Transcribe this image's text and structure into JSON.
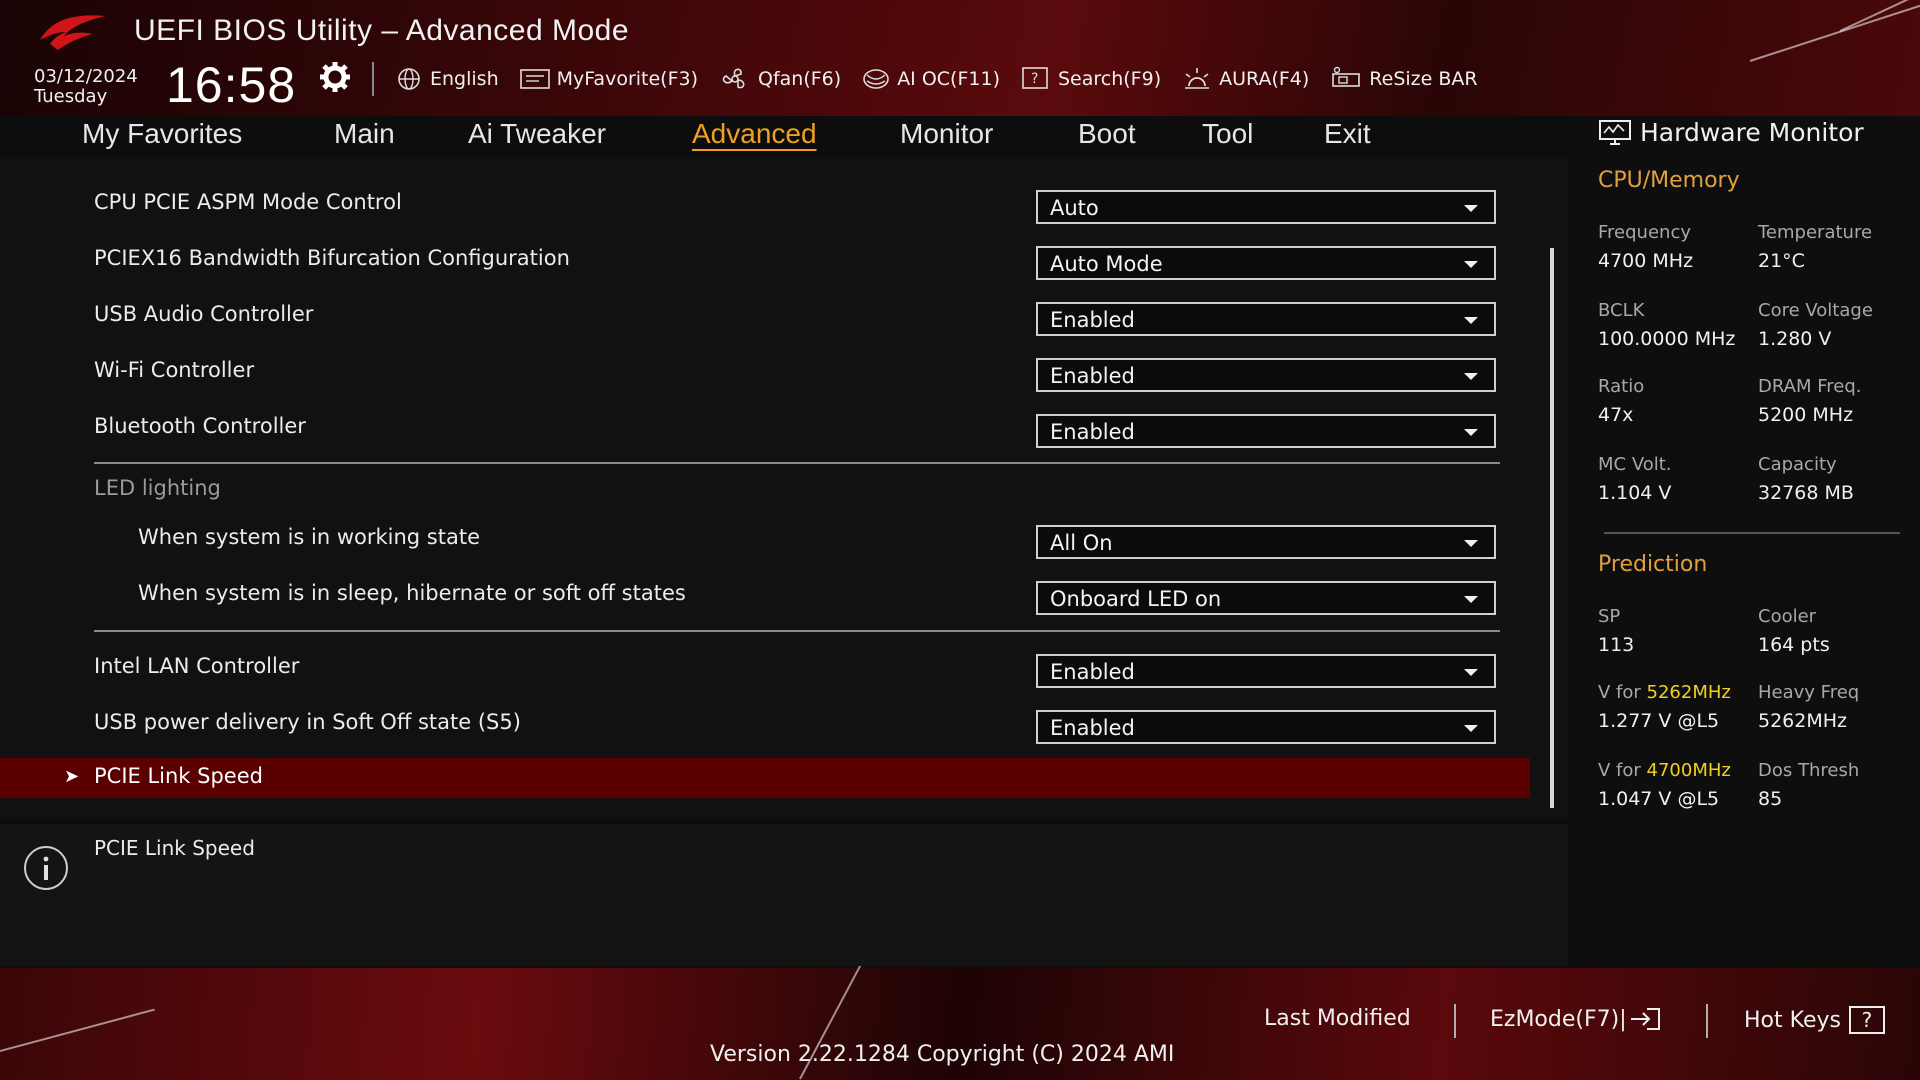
{
  "app": {
    "title": "UEFI BIOS Utility – Advanced Mode",
    "date": "03/12/2024",
    "day": "Tuesday",
    "time": "16:58"
  },
  "toolbar": {
    "items": [
      {
        "label": "English",
        "icon": "globe-icon"
      },
      {
        "label": "MyFavorite(F3)",
        "icon": "favorite-list-icon"
      },
      {
        "label": "Qfan(F6)",
        "icon": "fan-icon"
      },
      {
        "label": "AI OC(F11)",
        "icon": "ai-chip-icon"
      },
      {
        "label": "Search(F9)",
        "icon": "search-help-icon"
      },
      {
        "label": "AURA(F4)",
        "icon": "aura-light-icon"
      },
      {
        "label": "ReSize BAR",
        "icon": "resize-bar-icon"
      }
    ]
  },
  "nav": {
    "tabs": [
      {
        "label": "My Favorites",
        "active": false
      },
      {
        "label": "Main",
        "active": false
      },
      {
        "label": "Ai Tweaker",
        "active": false
      },
      {
        "label": "Advanced",
        "active": true
      },
      {
        "label": "Monitor",
        "active": false
      },
      {
        "label": "Boot",
        "active": false
      },
      {
        "label": "Tool",
        "active": false
      },
      {
        "label": "Exit",
        "active": false
      }
    ]
  },
  "settings": {
    "rows": [
      {
        "label": "CPU PCIE ASPM Mode Control",
        "value": "Auto"
      },
      {
        "label": "PCIEX16 Bandwidth Bifurcation Configuration",
        "value": "Auto Mode"
      },
      {
        "label": "USB Audio Controller",
        "value": "Enabled"
      },
      {
        "label": "Wi-Fi Controller",
        "value": "Enabled"
      },
      {
        "label": "Bluetooth Controller",
        "value": "Enabled"
      }
    ],
    "led_section": "LED lighting",
    "led_rows": [
      {
        "label": "When system is in working state",
        "value": "All On"
      },
      {
        "label": "When system is in sleep, hibernate or soft off states",
        "value": "Onboard LED on"
      }
    ],
    "rows2": [
      {
        "label": "Intel LAN Controller",
        "value": "Enabled"
      },
      {
        "label": "USB power delivery in Soft Off state (S5)",
        "value": "Enabled"
      }
    ],
    "submenu": {
      "arrow": "➤",
      "label": "PCIE Link Speed"
    }
  },
  "help": {
    "text": "PCIE Link Speed"
  },
  "hardware_monitor": {
    "title": "Hardware Monitor",
    "cpu_memory": {
      "title": "CPU/Memory",
      "frequency_label": "Frequency",
      "frequency": "4700 MHz",
      "temperature_label": "Temperature",
      "temperature": "21°C",
      "bclk_label": "BCLK",
      "bclk": "100.0000 MHz",
      "core_voltage_label": "Core Voltage",
      "core_voltage": "1.280 V",
      "ratio_label": "Ratio",
      "ratio": "47x",
      "dram_freq_label": "DRAM Freq.",
      "dram_freq": "5200 MHz",
      "mc_volt_label": "MC Volt.",
      "mc_volt": "1.104 V",
      "capacity_label": "Capacity",
      "capacity": "32768 MB"
    },
    "prediction": {
      "title": "Prediction",
      "sp_label": "SP",
      "sp": "113",
      "cooler_label": "Cooler",
      "cooler": "164 pts",
      "v_for_label_1": "V for ",
      "v_for_freq_1": "5262MHz",
      "v_for_value_1": "1.277 V @L5",
      "heavy_freq_label": "Heavy Freq",
      "heavy_freq": "5262MHz",
      "v_for_label_2": "V for ",
      "v_for_freq_2": "4700MHz",
      "v_for_value_2": "1.047 V @L5",
      "dos_thresh_label": "Dos Thresh",
      "dos_thresh": "85"
    }
  },
  "footer": {
    "last_modified": "Last Modified",
    "ezmode": "EzMode(F7)|",
    "hotkeys": "Hot Keys",
    "hotkeys_key": "?",
    "version": "Version 2.22.1284 Copyright (C) 2024 AMI"
  },
  "colors": {
    "accent": "#f0a020",
    "selected_row": "#5a0000",
    "highlight": "#f2d020",
    "brand_red": "#c0101a"
  }
}
